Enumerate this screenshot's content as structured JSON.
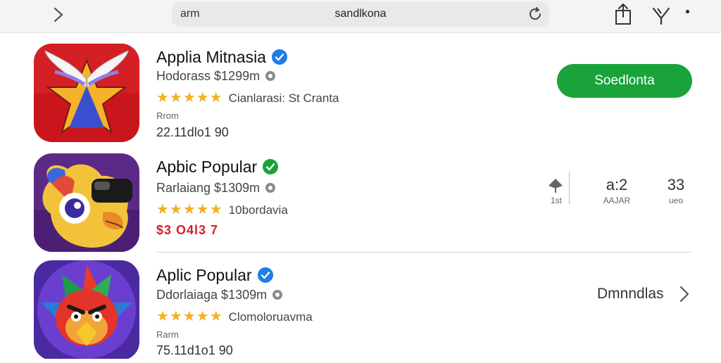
{
  "toolbar": {
    "url_left": "arm",
    "url_text": "sandlkona"
  },
  "apps": [
    {
      "name": "Applia Mitnasia",
      "developer": "Hodorass $1299m",
      "stars": "★★★★★",
      "rating_label": "Cianlarasi: St Cranta",
      "small": "Rrom",
      "meta": "22.11dlo1 90"
    },
    {
      "name": "Apbic Popular",
      "developer": "Rarlaiang $1309m",
      "stars": "★★★★★",
      "rating_label": "10bordavia",
      "meta": "$3 O4l3 7"
    },
    {
      "name": "Aplic Popular",
      "developer": "Ddorlaiaga $1309m",
      "stars": "★★★★★",
      "rating_label": "Clomoloruavma",
      "small": "Rarm",
      "meta": "75.11d1o1 90"
    }
  ],
  "get_button": "Soedlonta",
  "stats": [
    {
      "label": "1st"
    },
    {
      "value": "a:2",
      "label": "AAJAR"
    },
    {
      "value": "33",
      "label": "ueo"
    }
  ],
  "more_link": "Dmnndlas",
  "colors": {
    "accent_green": "#1aa33a",
    "verified_blue": "#1f7be6",
    "verified_green": "#1aa33a",
    "star": "#f2b01e",
    "price_red": "#d5202a"
  },
  "icons": [
    "chevron-left-icon",
    "reload-icon",
    "share-icon",
    "fork-icon",
    "more-dot-icon",
    "verified-icon",
    "info-icon",
    "star-icon",
    "pin-icon",
    "chevron-right-icon"
  ]
}
